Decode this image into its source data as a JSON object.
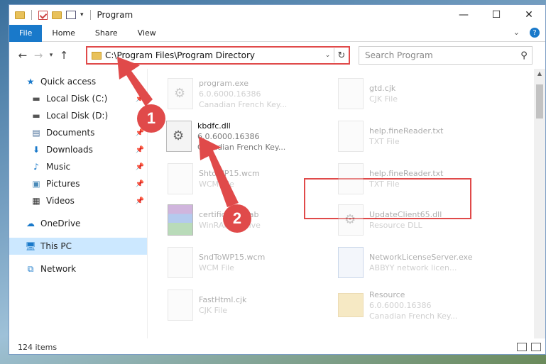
{
  "window": {
    "title": "Program",
    "buttons": {
      "minimize": "—",
      "maximize": "☐",
      "close": "✕"
    }
  },
  "ribbon": {
    "tabs": [
      {
        "label": "File"
      },
      {
        "label": "Home"
      },
      {
        "label": "Share"
      },
      {
        "label": "View"
      }
    ],
    "help": "?"
  },
  "navigation": {
    "address": "C:\\Program Files\\Program Directory",
    "search_placeholder": "Search Program"
  },
  "sidebar": {
    "quick_access": "Quick access",
    "items": [
      {
        "label": "Local Disk (C:)",
        "icon": "drive-icon",
        "pinned": true
      },
      {
        "label": "Local Disk (D:)",
        "icon": "drive-icon",
        "pinned": false
      },
      {
        "label": "Documents",
        "icon": "documents-icon",
        "pinned": true
      },
      {
        "label": "Downloads",
        "icon": "downloads-icon",
        "pinned": true
      },
      {
        "label": "Music",
        "icon": "music-icon",
        "pinned": true
      },
      {
        "label": "Pictures",
        "icon": "pictures-icon",
        "pinned": true
      },
      {
        "label": "Videos",
        "icon": "videos-icon",
        "pinned": true
      }
    ],
    "onedrive": "OneDrive",
    "this_pc": "This PC",
    "network": "Network"
  },
  "files": [
    {
      "name": "program.exe",
      "line2": "6.0.6000.16386",
      "line3": "Canadian French Key...",
      "icon": "gear"
    },
    {
      "name": "gtd.cjk",
      "line2": "CJK File",
      "line3": "",
      "icon": "doc"
    },
    {
      "name": "kbdfc.dll",
      "line2": "6.0.6000.16386",
      "line3": "Canadian French Key...",
      "icon": "gear"
    },
    {
      "name": "help.fineReader.txt",
      "line2": "TXT File",
      "line3": "",
      "icon": "doc"
    },
    {
      "name": "ShtoWP15.wcm",
      "line2": "WCM File",
      "line3": "",
      "icon": "doc"
    },
    {
      "name": "help.fineReader.txt",
      "line2": "TXT File",
      "line3": "",
      "icon": "doc"
    },
    {
      "name": "certificates.cab",
      "line2": "WinRAR archive",
      "line3": "",
      "icon": "rar"
    },
    {
      "name": "UpdateClient65.dll",
      "line2": "Resource DLL",
      "line3": "",
      "icon": "gear"
    },
    {
      "name": "SndToWP15.wcm",
      "line2": "WCM File",
      "line3": "",
      "icon": "doc"
    },
    {
      "name": "NetworkLicenseServer.exe",
      "line2": "ABBYY network licen...",
      "line3": "",
      "icon": "app"
    },
    {
      "name": "FastHtml.cjk",
      "line2": "CJK File",
      "line3": "",
      "icon": "doc"
    },
    {
      "name": "Resource",
      "line2": "6.0.6000.16386",
      "line3": "Canadian French Key...",
      "icon": "folder"
    }
  ],
  "status": {
    "count": "124 items"
  },
  "annotations": {
    "step1": "1",
    "step2": "2",
    "color": "#e04a4a"
  }
}
